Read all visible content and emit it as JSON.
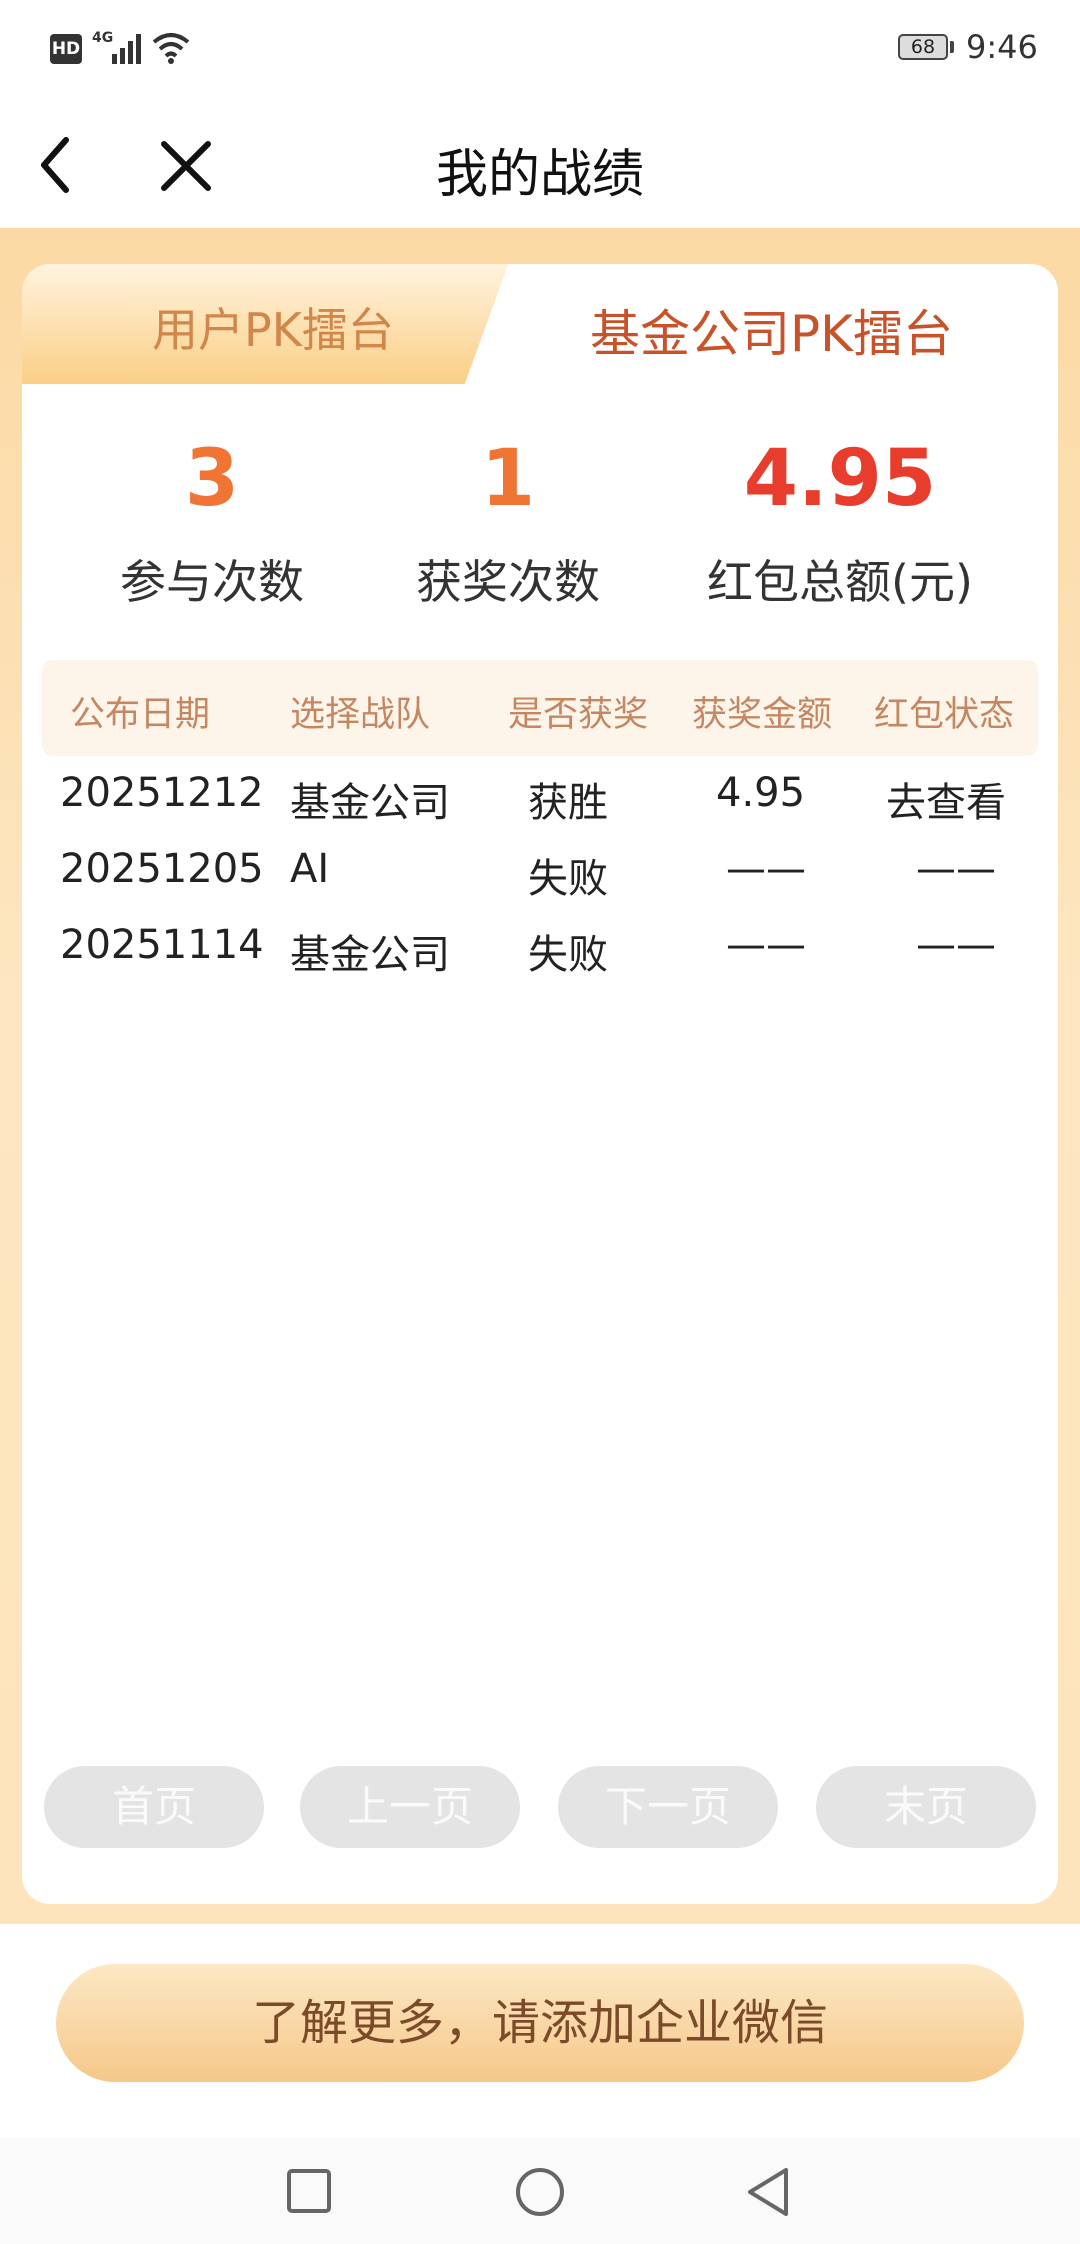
{
  "status_bar": {
    "hd": "HD",
    "network": "4G",
    "battery": "68",
    "time": "9:46"
  },
  "header": {
    "title": "我的战绩"
  },
  "tabs": [
    {
      "label": "用户PK擂台",
      "active": false
    },
    {
      "label": "基金公司PK擂台",
      "active": true
    }
  ],
  "stats": [
    {
      "value": "3",
      "label": "参与次数",
      "color": "#f07535"
    },
    {
      "value": "1",
      "label": "获奖次数",
      "color": "#f07535"
    },
    {
      "value": "4.95",
      "label": "红包总额(元)",
      "color": "#e83d2c"
    }
  ],
  "table": {
    "headers": [
      "公布日期",
      "选择战队",
      "是否获奖",
      "获奖金额",
      "红包状态"
    ],
    "rows": [
      [
        "20251212",
        "基金公司",
        "获胜",
        "4.95",
        "去查看"
      ],
      [
        "20251205",
        "AI",
        "失败",
        "——",
        "——"
      ],
      [
        "20251114",
        "基金公司",
        "失败",
        "——",
        "——"
      ]
    ]
  },
  "pagination": {
    "first": "首页",
    "prev": "上一页",
    "next": "下一页",
    "last": "末页"
  },
  "cta": {
    "label": "了解更多，请添加企业微信"
  },
  "colors": {
    "accent_orange": "#f07535",
    "accent_red": "#e83d2c",
    "tab_active_text": "#c8532a",
    "panel_bg": "#fcd9a4"
  }
}
